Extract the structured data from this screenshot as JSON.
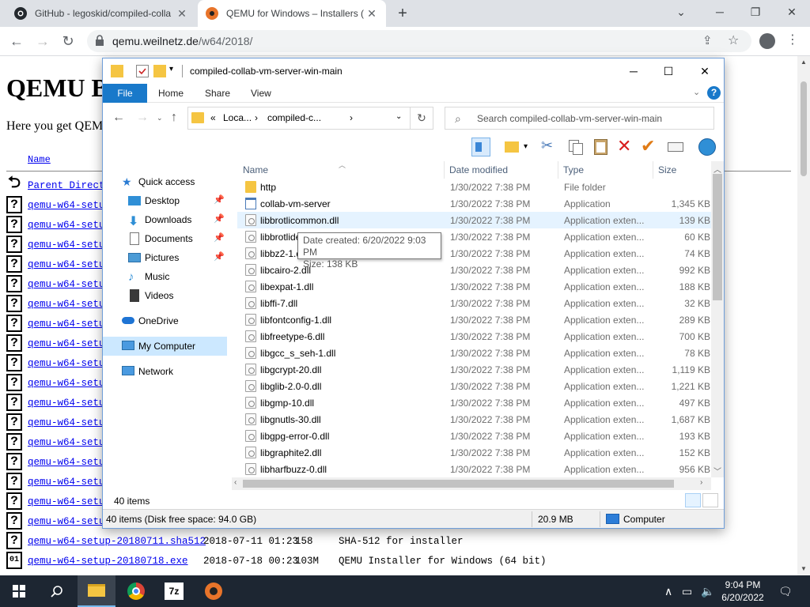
{
  "chrome": {
    "tabs": [
      {
        "title": "GitHub - legoskid/compiled-colla",
        "icon": "github-icon"
      },
      {
        "title": "QEMU for Windows – Installers (",
        "icon": "qemu-icon"
      }
    ],
    "url_host": "qemu.weilnetz.de",
    "url_path": "/w64/2018/",
    "new_tab": "+",
    "min": "─",
    "max": "❐",
    "close": "✕"
  },
  "webpage": {
    "title": "QEMU Binaries for Windows (64 bit)",
    "intro": "Here you get QEMU related binaries for Windows (64 bit).",
    "col_name": "Name",
    "parent": "Parent Directory",
    "truncated_link": "qemu-w64-setu",
    "truncated_link2": "qemu-w64-setup-201",
    "rows": [
      {
        "name": "qemu-w64-setup-20180711.sha512",
        "date": "2018-07-11 01:23",
        "size": "158",
        "desc": "SHA-512 for installer"
      },
      {
        "name": "qemu-w64-setup-20180718.exe",
        "date": "2018-07-18 00:23",
        "size": "103M",
        "desc": "QEMU Installer for Windows (64 bit)"
      }
    ]
  },
  "explorer": {
    "title": "compiled-collab-vm-server-win-main",
    "ribbon": {
      "file": "File",
      "home": "Home",
      "share": "Share",
      "view": "View"
    },
    "address": {
      "prefix": "«",
      "seg1": "Loca...",
      "seg2": "compiled-c...",
      "chev": "›"
    },
    "search_placeholder": "Search compiled-collab-vm-server-win-main",
    "nav": {
      "quick_access": "Quick access",
      "desktop": "Desktop",
      "downloads": "Downloads",
      "documents": "Documents",
      "pictures": "Pictures",
      "music": "Music",
      "videos": "Videos",
      "onedrive": "OneDrive",
      "my_computer": "My Computer",
      "network": "Network"
    },
    "columns": {
      "name": "Name",
      "date": "Date modified",
      "type": "Type",
      "size": "Size"
    },
    "files": [
      {
        "name": "http",
        "date": "1/30/2022 7:38 PM",
        "type": "File folder",
        "size": "",
        "kind": "folder"
      },
      {
        "name": "collab-vm-server",
        "date": "1/30/2022 7:38 PM",
        "type": "Application",
        "size": "1,345 KB",
        "kind": "app"
      },
      {
        "name": "libbrotlicommon.dll",
        "date": "1/30/2022 7:38 PM",
        "type": "Application exten...",
        "size": "139 KB",
        "kind": "dll"
      },
      {
        "name": "libbrotlidec.dll",
        "date": "1/30/2022 7:38 PM",
        "type": "Application exten...",
        "size": "60 KB",
        "kind": "dll"
      },
      {
        "name": "libbz2-1.dll",
        "date": "1/30/2022 7:38 PM",
        "type": "Application exten...",
        "size": "74 KB",
        "kind": "dll"
      },
      {
        "name": "libcairo-2.dll",
        "date": "1/30/2022 7:38 PM",
        "type": "Application exten...",
        "size": "992 KB",
        "kind": "dll"
      },
      {
        "name": "libexpat-1.dll",
        "date": "1/30/2022 7:38 PM",
        "type": "Application exten...",
        "size": "188 KB",
        "kind": "dll"
      },
      {
        "name": "libffi-7.dll",
        "date": "1/30/2022 7:38 PM",
        "type": "Application exten...",
        "size": "32 KB",
        "kind": "dll"
      },
      {
        "name": "libfontconfig-1.dll",
        "date": "1/30/2022 7:38 PM",
        "type": "Application exten...",
        "size": "289 KB",
        "kind": "dll"
      },
      {
        "name": "libfreetype-6.dll",
        "date": "1/30/2022 7:38 PM",
        "type": "Application exten...",
        "size": "700 KB",
        "kind": "dll"
      },
      {
        "name": "libgcc_s_seh-1.dll",
        "date": "1/30/2022 7:38 PM",
        "type": "Application exten...",
        "size": "78 KB",
        "kind": "dll"
      },
      {
        "name": "libgcrypt-20.dll",
        "date": "1/30/2022 7:38 PM",
        "type": "Application exten...",
        "size": "1,119 KB",
        "kind": "dll"
      },
      {
        "name": "libglib-2.0-0.dll",
        "date": "1/30/2022 7:38 PM",
        "type": "Application exten...",
        "size": "1,221 KB",
        "kind": "dll"
      },
      {
        "name": "libgmp-10.dll",
        "date": "1/30/2022 7:38 PM",
        "type": "Application exten...",
        "size": "497 KB",
        "kind": "dll"
      },
      {
        "name": "libgnutls-30.dll",
        "date": "1/30/2022 7:38 PM",
        "type": "Application exten...",
        "size": "1,687 KB",
        "kind": "dll"
      },
      {
        "name": "libgpg-error-0.dll",
        "date": "1/30/2022 7:38 PM",
        "type": "Application exten...",
        "size": "193 KB",
        "kind": "dll"
      },
      {
        "name": "libgraphite2.dll",
        "date": "1/30/2022 7:38 PM",
        "type": "Application exten...",
        "size": "152 KB",
        "kind": "dll"
      },
      {
        "name": "libharfbuzz-0.dll",
        "date": "1/30/2022 7:38 PM",
        "type": "Application exten...",
        "size": "956 KB",
        "kind": "dll"
      }
    ],
    "tooltip": {
      "line1": "Date created: 6/20/2022 9:03 PM",
      "line2": "Size: 138 KB"
    },
    "status_count": "40 items",
    "bottom": {
      "left": "40 items (Disk free space: 94.0 GB)",
      "size": "20.9 MB",
      "location": "Computer"
    }
  },
  "taskbar": {
    "time": "9:04 PM",
    "date": "6/20/2022",
    "apps": [
      "start-icon",
      "search-icon",
      "file-explorer-icon",
      "chrome-icon",
      "7zip-icon",
      "qemu-icon"
    ],
    "sevenzip_label": "7z"
  }
}
